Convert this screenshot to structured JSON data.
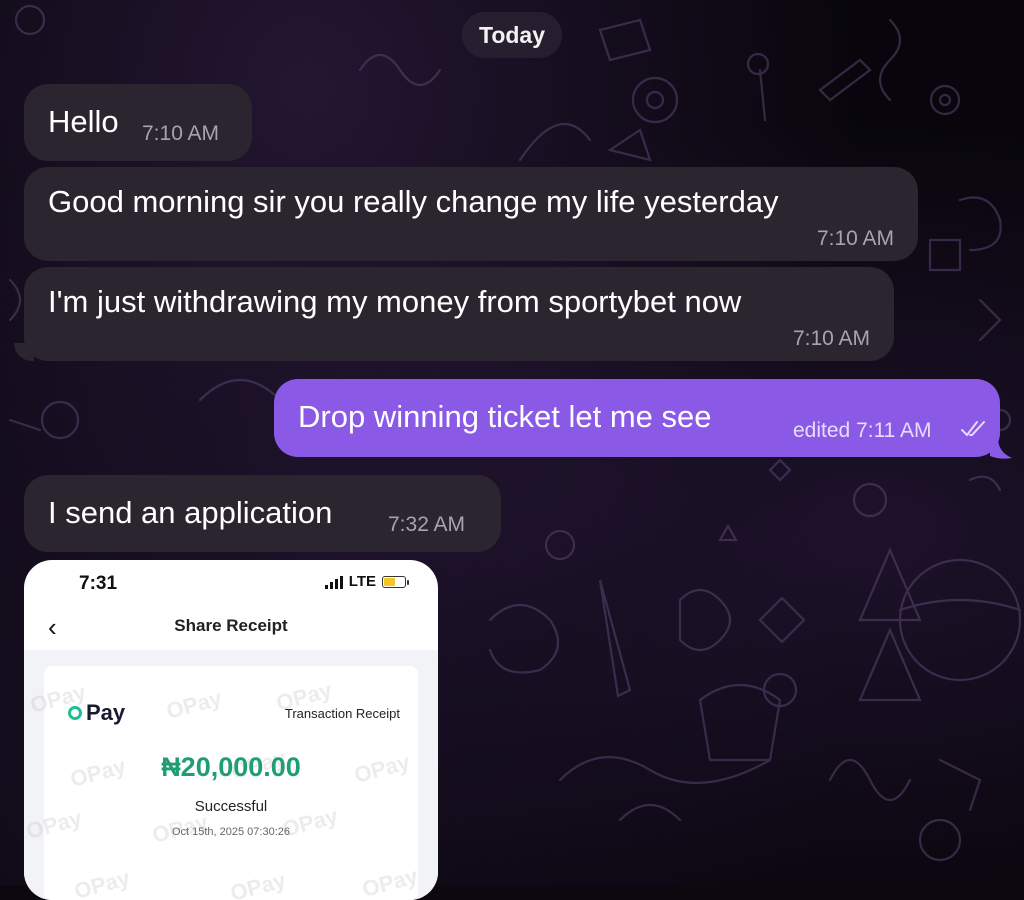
{
  "colors": {
    "incoming_bubble": "#2b2530",
    "outgoing_bubble": "#8a5ae6",
    "opay_green": "#1dbf93",
    "amount_green": "#1f9e70"
  },
  "date_divider": "Today",
  "messages": [
    {
      "text": "Hello",
      "time": "7:10 AM",
      "direction": "incoming"
    },
    {
      "text": "Good morning sir you really change my life yesterday",
      "time": "7:10 AM",
      "direction": "incoming"
    },
    {
      "text": "I'm just withdrawing my money from sportybet now",
      "time": "7:10 AM",
      "direction": "incoming"
    },
    {
      "text": "Drop winning ticket let me see",
      "time": "edited 7:11 AM",
      "direction": "outgoing",
      "status_icon": "double-check-icon"
    },
    {
      "text": "I send an application",
      "time": "7:32 AM",
      "direction": "incoming"
    }
  ],
  "receipt_screenshot": {
    "status_bar": {
      "time": "7:31",
      "network": "LTE",
      "icons": [
        "signal-icon",
        "battery-icon"
      ]
    },
    "nav": {
      "back_icon": "chevron-left-icon",
      "title": "Share Receipt"
    },
    "brand": "Pay",
    "watermark": "OPay",
    "receipt_title": "Transaction Receipt",
    "amount": "₦20,000.00",
    "status": "Successful",
    "date": "Oct 15th, 2025 07:30:26"
  }
}
